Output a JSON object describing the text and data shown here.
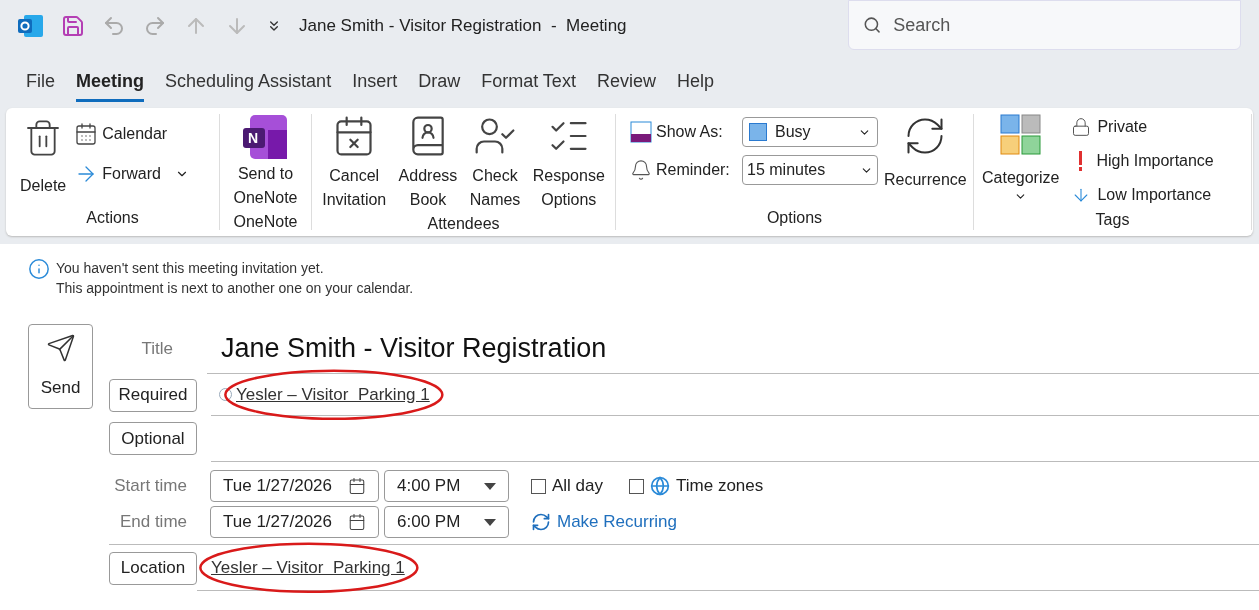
{
  "window": {
    "title": "Jane Smith - Visitor Registration  -  Meeting",
    "search_placeholder": "Search"
  },
  "tabs": [
    {
      "label": "File",
      "selected": false
    },
    {
      "label": "Meeting",
      "selected": true
    },
    {
      "label": "Scheduling Assistant",
      "selected": false
    },
    {
      "label": "Insert",
      "selected": false
    },
    {
      "label": "Draw",
      "selected": false
    },
    {
      "label": "Format Text",
      "selected": false
    },
    {
      "label": "Review",
      "selected": false
    },
    {
      "label": "Help",
      "selected": false
    }
  ],
  "ribbon": {
    "actions": {
      "group_label": "Actions",
      "delete": "Delete",
      "calendar": "Calendar",
      "forward": "Forward"
    },
    "onenote": {
      "group_label": "OneNote",
      "logo_letter": "N",
      "lines": [
        "Send to",
        "OneNote"
      ]
    },
    "attendees": {
      "group_label": "Attendees",
      "buttons": [
        {
          "kind": "cancel",
          "lines": [
            "Cancel",
            "Invitation"
          ]
        },
        {
          "kind": "book",
          "lines": [
            "Address",
            "Book"
          ]
        },
        {
          "kind": "check",
          "lines": [
            "Check",
            "Names"
          ]
        },
        {
          "kind": "response",
          "lines": [
            "Response",
            "Options"
          ]
        }
      ]
    },
    "options": {
      "group_label": "Options",
      "show_as_label": "Show As:",
      "show_as_value": "Busy",
      "reminder_label": "Reminder:",
      "reminder_value": "15 minutes",
      "recurrence": "Recurrence"
    },
    "tags": {
      "group_label": "Tags",
      "categorize": "Categorize",
      "private": "Private",
      "high": "High Importance",
      "low": "Low Importance"
    }
  },
  "info": [
    "You haven't sent this meeting invitation yet.",
    "This appointment is next to another one on your calendar."
  ],
  "form": {
    "send": "Send",
    "title_label": "Title",
    "title_value": "Jane Smith - Visitor Registration",
    "required_button": "Required",
    "required_value": "Yesler – Visitor  Parking 1",
    "optional_button": "Optional",
    "start_label": "Start time",
    "start_date": "Tue 1/27/2026",
    "start_time": "4:00 PM",
    "end_label": "End time",
    "end_date": "Tue 1/27/2026",
    "end_time": "6:00 PM",
    "all_day": {
      "label": "All day",
      "checked": false
    },
    "time_zones": {
      "label": "Time zones",
      "checked": false
    },
    "make_recurring": "Make Recurring",
    "location_button": "Location",
    "location_value": "Yesler – Visitor  Parking 1"
  }
}
